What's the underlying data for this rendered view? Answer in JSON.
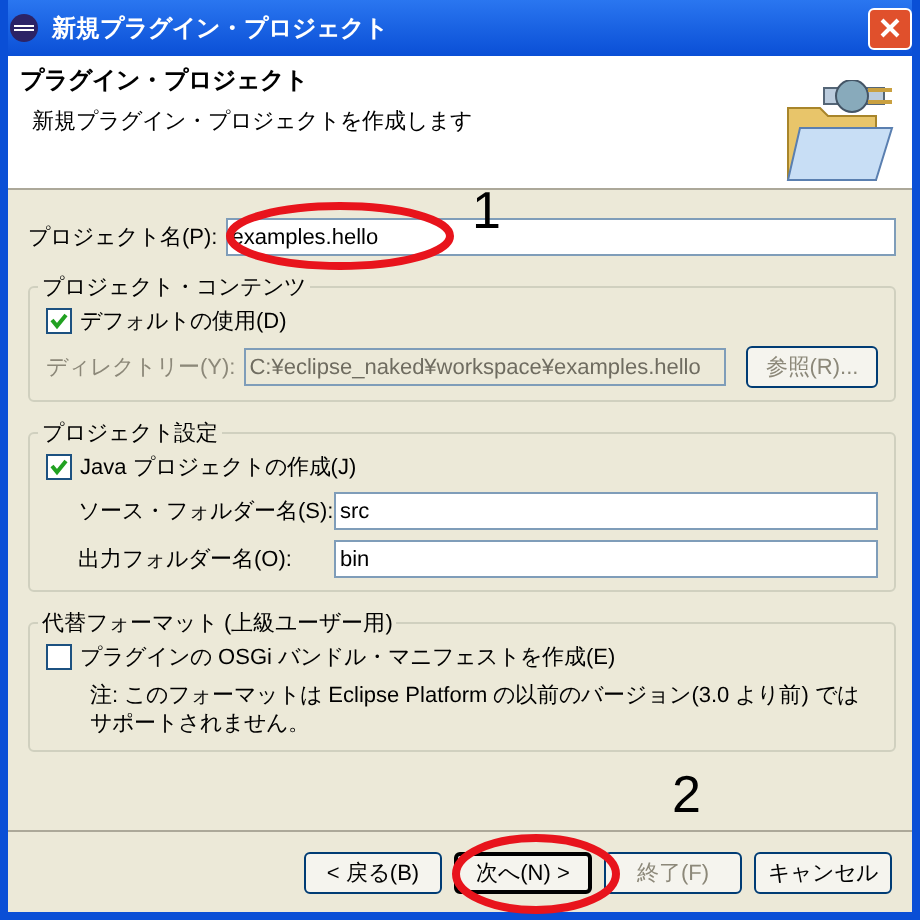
{
  "window": {
    "title": "新規プラグイン・プロジェクト"
  },
  "header": {
    "title": "プラグイン・プロジェクト",
    "description": "新規プラグイン・プロジェクトを作成します"
  },
  "project_name": {
    "label": "プロジェクト名(P):",
    "value": "examples.hello"
  },
  "contents_group": {
    "title": "プロジェクト・コンテンツ",
    "use_default": {
      "label": "デフォルトの使用(D)",
      "checked": true
    },
    "directory": {
      "label": "ディレクトリー(Y):",
      "value": "C:¥eclipse_naked¥workspace¥examples.hello",
      "disabled": true
    },
    "browse_button": {
      "label": "参照(R)...",
      "disabled": true
    }
  },
  "settings_group": {
    "title": "プロジェクト設定",
    "java_project": {
      "label": "Java プロジェクトの作成(J)",
      "checked": true
    },
    "fields": [
      {
        "label": "ソース・フォルダー名(S):",
        "value": "src"
      },
      {
        "label": "出力フォルダー名(O):",
        "value": "bin"
      }
    ]
  },
  "format_group": {
    "title": "代替フォーマット (上級ユーザー用)",
    "manifest": {
      "label": "プラグインの OSGi バンドル・マニフェストを作成(E)",
      "checked": false
    },
    "note": "注: このフォーマットは Eclipse Platform の以前のバージョン(3.0 より前) ではサポートされません。"
  },
  "buttons": [
    {
      "label": "< 戻る(B)",
      "disabled": false,
      "default": false
    },
    {
      "label": "次へ(N) >",
      "disabled": false,
      "default": true
    },
    {
      "label": "終了(F)",
      "disabled": true,
      "default": false
    },
    {
      "label": "キャンセル",
      "disabled": false,
      "default": false
    }
  ],
  "annotations": [
    {
      "kind": "ellipse",
      "number": "1"
    },
    {
      "kind": "ellipse",
      "number": "2"
    }
  ]
}
